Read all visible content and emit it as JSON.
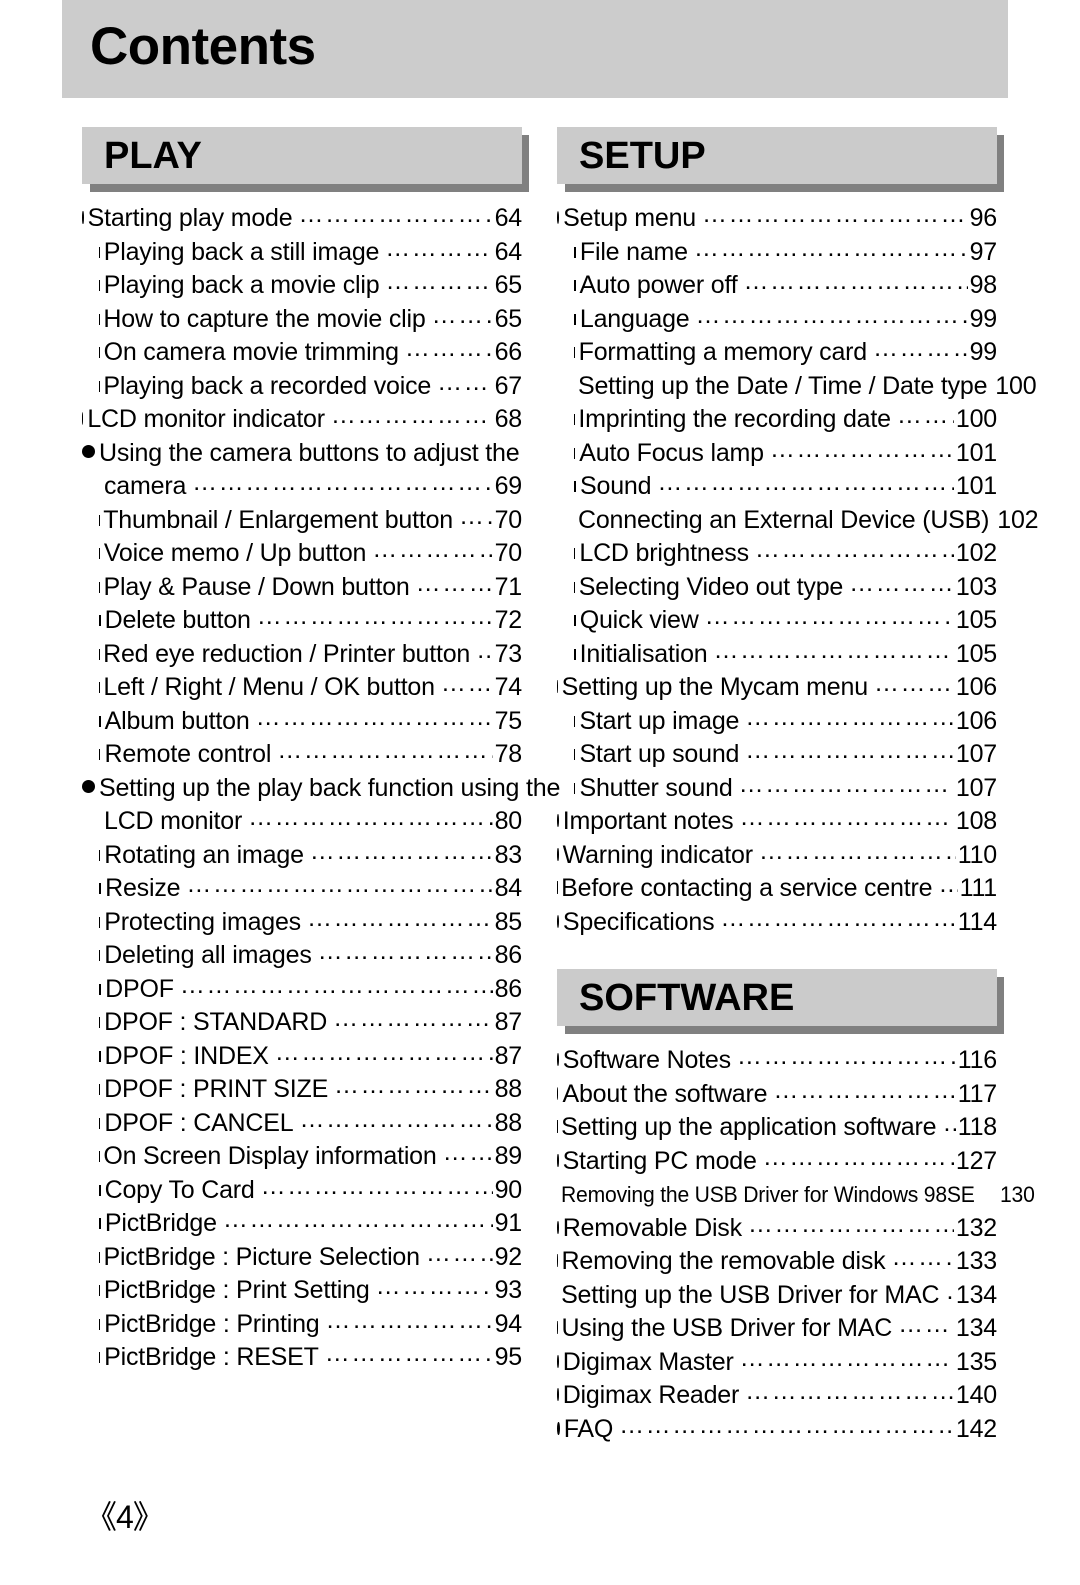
{
  "page": {
    "title": "Contents",
    "page_number": "《4》"
  },
  "columns": {
    "left": [
      {
        "section_title": "PLAY",
        "entries": [
          {
            "level": 1,
            "label": "Starting play mode",
            "page": "64"
          },
          {
            "level": 2,
            "label": "Playing back a still image",
            "page": "64"
          },
          {
            "level": 2,
            "label": "Playing back a movie clip",
            "page": "65"
          },
          {
            "level": 2,
            "label": "How to capture the movie clip",
            "page": "65"
          },
          {
            "level": 2,
            "label": "On camera movie trimming",
            "page": "66"
          },
          {
            "level": 2,
            "label": "Playing back a recorded voice",
            "page": "67"
          },
          {
            "level": 1,
            "label": "LCD monitor indicator",
            "page": "68"
          },
          {
            "level": 1,
            "label": "Using the camera buttons to adjust the",
            "label2": "camera",
            "page": "69",
            "wrap": true
          },
          {
            "level": 2,
            "label": "Thumbnail / Enlargement button",
            "page": "70"
          },
          {
            "level": 2,
            "label": "Voice  memo / Up button",
            "page": "70"
          },
          {
            "level": 2,
            "label": "Play & Pause / Down button",
            "page": "71"
          },
          {
            "level": 2,
            "label": "Delete button",
            "page": "72"
          },
          {
            "level": 2,
            "label": " Red eye reduction  / Printer button",
            "page": "73"
          },
          {
            "level": 2,
            "label": "Left / Right / Menu / OK button",
            "page": "74"
          },
          {
            "level": 2,
            "label": "Album button",
            "page": "75"
          },
          {
            "level": 2,
            "label": "Remote control",
            "page": "78"
          },
          {
            "level": 1,
            "label": "Setting up the play back function using the",
            "label2": "LCD monitor",
            "page": "80",
            "wrap": true
          },
          {
            "level": 2,
            "label": "Rotating an image",
            "page": "83"
          },
          {
            "level": 2,
            "label": "Resize",
            "page": "84"
          },
          {
            "level": 2,
            "label": "Protecting images",
            "page": "85"
          },
          {
            "level": 2,
            "label": "Deleting all images",
            "page": "86"
          },
          {
            "level": 2,
            "label": "DPOF",
            "page": "86"
          },
          {
            "level": 2,
            "label": "DPOF : STANDARD",
            "page": "87"
          },
          {
            "level": 2,
            "label": "DPOF : INDEX",
            "page": "87"
          },
          {
            "level": 2,
            "label": "DPOF : PRINT SIZE",
            "page": "88"
          },
          {
            "level": 2,
            "label": "DPOF : CANCEL",
            "page": "88"
          },
          {
            "level": 2,
            "label": "On Screen Display information",
            "page": "89"
          },
          {
            "level": 2,
            "label": "Copy To Card",
            "page": "90"
          },
          {
            "level": 2,
            "label": "PictBridge",
            "page": "91"
          },
          {
            "level": 2,
            "label": "PictBridge : Picture Selection",
            "page": "92"
          },
          {
            "level": 2,
            "label": "PictBridge : Print Setting",
            "page": "93"
          },
          {
            "level": 2,
            "label": "PictBridge : Printing",
            "page": "94"
          },
          {
            "level": 2,
            "label": "PictBridge : RESET",
            "page": "95"
          }
        ]
      }
    ],
    "right": [
      {
        "section_title": "SETUP",
        "entries": [
          {
            "level": 1,
            "label": "Setup menu",
            "page": "96"
          },
          {
            "level": 2,
            "label": "File name",
            "page": "97"
          },
          {
            "level": 2,
            "label": "Auto power off",
            "page": "98"
          },
          {
            "level": 2,
            "label": "Language",
            "page": "99"
          },
          {
            "level": 2,
            "label": "Formatting a memory card",
            "page": "99"
          },
          {
            "level": 2,
            "label": "Setting up the Date / Time / Date type",
            "page": "100"
          },
          {
            "level": 2,
            "label": "Imprinting the recording date",
            "page": "100"
          },
          {
            "level": 2,
            "label": "Auto Focus lamp",
            "page": "101"
          },
          {
            "level": 2,
            "label": "Sound",
            "page": "101"
          },
          {
            "level": 2,
            "label": "Connecting an External Device (USB)",
            "page": "102"
          },
          {
            "level": 2,
            "label": "LCD brightness",
            "page": "102"
          },
          {
            "level": 2,
            "label": "Selecting Video out type",
            "page": "103"
          },
          {
            "level": 2,
            "label": "Quick view",
            "page": "105"
          },
          {
            "level": 2,
            "label": "Initialisation",
            "page": "105"
          },
          {
            "level": 1,
            "label": "Setting up the Mycam menu",
            "page": "106"
          },
          {
            "level": 2,
            "label": "Start up image",
            "page": "106"
          },
          {
            "level": 2,
            "label": "Start up sound",
            "page": "107"
          },
          {
            "level": 2,
            "label": "Shutter sound",
            "page": "107"
          },
          {
            "level": 1,
            "label": "Important notes",
            "page": "108"
          },
          {
            "level": 1,
            "label": "Warning indicator",
            "page": "110"
          },
          {
            "level": 1,
            "label": "Before contacting a service centre",
            "page": "111"
          },
          {
            "level": 1,
            "label": "Specifications",
            "page": "114"
          }
        ]
      },
      {
        "section_title": "SOFTWARE",
        "entries": [
          {
            "level": 1,
            "label": "Software Notes",
            "page": "116"
          },
          {
            "level": 1,
            "label": "About the software",
            "page": "117"
          },
          {
            "level": 1,
            "label": "Setting up the application software",
            "page": "118"
          },
          {
            "level": 1,
            "label": "Starting PC mode",
            "page": "127"
          },
          {
            "level": 1,
            "label": "Removing the USB Driver for Windows 98SE",
            "page": "130",
            "condensed": true
          },
          {
            "level": 1,
            "label": "Removable Disk",
            "page": "132"
          },
          {
            "level": 1,
            "label": "Removing the removable disk",
            "page": "133"
          },
          {
            "level": 1,
            "label": "Setting up the USB Driver for MAC",
            "page": "134"
          },
          {
            "level": 1,
            "label": "Using the USB Driver for MAC",
            "page": "134"
          },
          {
            "level": 1,
            "label": "Digimax Master",
            "page": "135"
          },
          {
            "level": 1,
            "label": "Digimax Reader",
            "page": "140"
          },
          {
            "level": 1,
            "label": "FAQ",
            "page": "142"
          }
        ]
      }
    ]
  }
}
